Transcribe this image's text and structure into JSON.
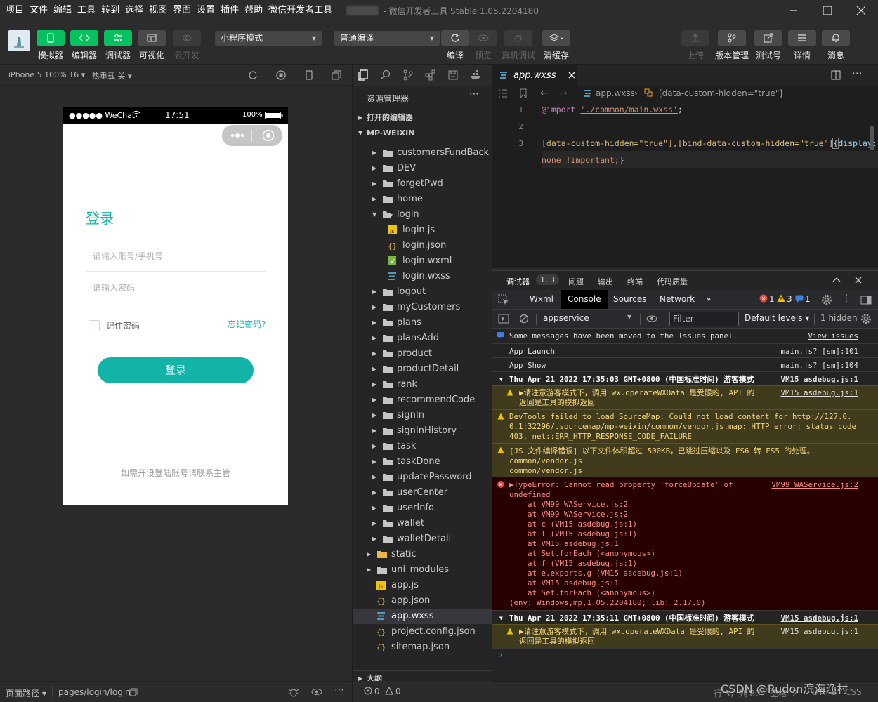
{
  "menu": [
    "项目",
    "文件",
    "编辑",
    "工具",
    "转到",
    "选择",
    "视图",
    "界面",
    "设置",
    "插件",
    "帮助",
    "微信开发者工具"
  ],
  "window_title": "- 微信开发者工具 Stable 1.05.2204180",
  "toolbar": {
    "simulator": "模拟器",
    "editor": "编辑器",
    "debugger": "调试器",
    "visual": "可视化",
    "cloud": "云开发",
    "mode_select": "小程序模式",
    "compile_select": "普通编译",
    "compile": "编译",
    "preview": "预览",
    "real_debug": "真机调试",
    "clear_cache": "清缓存",
    "upload": "上传",
    "version": "版本管理",
    "test_no": "测试号",
    "details": "详情",
    "messages": "消息"
  },
  "sim": {
    "device": "iPhone 5 100% 16",
    "hot_reload": "热重载 关",
    "status": {
      "carrier": "●●●●● WeChat",
      "time": "17:51",
      "battery": "100%"
    },
    "login_title": "登录",
    "account_placeholder": "请输入账号/手机号",
    "password_placeholder": "请输入密码",
    "remember": "记住密码",
    "forgot": "忘记密码?",
    "login_button": "登录",
    "contact": "如需开设登陆账号请联系主管",
    "path_label": "页面路径",
    "path": "pages/login/login"
  },
  "explorer": {
    "title": "资源管理器",
    "open_editors": "打开的编辑器",
    "project": "MP-WEIXIN",
    "outline": "大纲",
    "tree": [
      {
        "name": "customersFundBack",
        "type": "folder",
        "depth": 1,
        "open": false
      },
      {
        "name": "DEV",
        "type": "folder",
        "depth": 1,
        "open": false
      },
      {
        "name": "forgetPwd",
        "type": "folder",
        "depth": 1,
        "open": false
      },
      {
        "name": "home",
        "type": "folder",
        "depth": 1,
        "open": false
      },
      {
        "name": "login",
        "type": "folder",
        "depth": 1,
        "open": true
      },
      {
        "name": "login.js",
        "type": "js",
        "depth": 2
      },
      {
        "name": "login.json",
        "type": "json",
        "depth": 2
      },
      {
        "name": "login.wxml",
        "type": "wxml",
        "depth": 2
      },
      {
        "name": "login.wxss",
        "type": "wxss",
        "depth": 2
      },
      {
        "name": "logout",
        "type": "folder",
        "depth": 1,
        "open": false
      },
      {
        "name": "myCustomers",
        "type": "folder",
        "depth": 1,
        "open": false
      },
      {
        "name": "plans",
        "type": "folder",
        "depth": 1,
        "open": false
      },
      {
        "name": "plansAdd",
        "type": "folder",
        "depth": 1,
        "open": false
      },
      {
        "name": "product",
        "type": "folder",
        "depth": 1,
        "open": false
      },
      {
        "name": "productDetail",
        "type": "folder",
        "depth": 1,
        "open": false
      },
      {
        "name": "rank",
        "type": "folder",
        "depth": 1,
        "open": false
      },
      {
        "name": "recommendCode",
        "type": "folder",
        "depth": 1,
        "open": false
      },
      {
        "name": "signIn",
        "type": "folder",
        "depth": 1,
        "open": false
      },
      {
        "name": "signInHistory",
        "type": "folder",
        "depth": 1,
        "open": false
      },
      {
        "name": "task",
        "type": "folder",
        "depth": 1,
        "open": false
      },
      {
        "name": "taskDone",
        "type": "folder",
        "depth": 1,
        "open": false
      },
      {
        "name": "updatePassword",
        "type": "folder",
        "depth": 1,
        "open": false
      },
      {
        "name": "userCenter",
        "type": "folder",
        "depth": 1,
        "open": false
      },
      {
        "name": "userInfo",
        "type": "folder",
        "depth": 1,
        "open": false
      },
      {
        "name": "wallet",
        "type": "folder",
        "depth": 1,
        "open": false
      },
      {
        "name": "walletDetail",
        "type": "folder",
        "depth": 1,
        "open": false
      },
      {
        "name": "static",
        "type": "folder-yellow",
        "depth": 0,
        "open": false
      },
      {
        "name": "uni_modules",
        "type": "folder",
        "depth": 0,
        "open": false
      },
      {
        "name": "app.js",
        "type": "js",
        "depth": 0
      },
      {
        "name": "app.json",
        "type": "json",
        "depth": 0
      },
      {
        "name": "app.wxss",
        "type": "wxss",
        "depth": 0,
        "selected": true
      },
      {
        "name": "project.config.json",
        "type": "json",
        "depth": 0
      },
      {
        "name": "sitemap.json",
        "type": "json",
        "depth": 0
      }
    ],
    "problems": "0",
    "warnings": "0"
  },
  "editor": {
    "tab": "app.wxss",
    "breadcrumb_file": "app.wxss",
    "breadcrumb_selector": "[data-custom-hidden=\"true\"]",
    "line_numbers": [
      "1",
      "2",
      "3"
    ],
    "code": {
      "l1_kw": "@import",
      "l1_str": "'./common/main.wxss'",
      "l1_end": ";",
      "l3_a": "[data-custom-hidden=\"true\"],[bind-data-custom-hidden=\"true\"]",
      "l3_brace": "{",
      "l3_prop": "display",
      "l3_colon": ":",
      "l3w_val": "none !important",
      "l3w_end": ";}"
    }
  },
  "debugger": {
    "title": "调试器",
    "badge": "1, 3",
    "problems": "问题",
    "output": "输出",
    "terminal": "终端",
    "quality": "代码质量",
    "tabs": [
      "Wxml",
      "Console",
      "Sources",
      "Network"
    ],
    "more_tabs": "»",
    "err_count": "1",
    "warn_count": "3",
    "info_count": "1",
    "context": "appservice",
    "filter_placeholder": "Filter",
    "levels": "Default levels",
    "hidden": "1 hidden",
    "messages": {
      "issues_moved": "Some messages have been moved to the Issues panel.",
      "view_issues": "View issues",
      "app_launch": "App Launch",
      "app_launch_src": "main.js? [sm]:101",
      "app_show": "App Show",
      "app_show_src": "main.js? [sm]:104",
      "group1": "Thu Apr 21 2022 17:35:03 GMT+0800 (中国标准时间) 游客模式",
      "group_src": "VM15 asdebug.js:1",
      "guest_warn_1": "▶请注意游客模式下，调用 wx.operateWXData 是受限的, API 的",
      "guest_warn_2": "返回是工具的模拟返回",
      "sourcemap_1": "DevTools failed to load SourceMap: Could not load content for ",
      "sourcemap_link_1": "http://127.0.",
      "sourcemap_link_2": "0.1:32296/.sourcemap/mp-weixin/common/vendor.js.map",
      "sourcemap_2": ": HTTP error: status code",
      "sourcemap_3": "403, net::ERR_HTTP_RESPONSE_CODE_FAILURE",
      "compile_1": "[JS 文件编译错误] 以下文件体积超过 500KB，已跳过压缩以及 ES6 转 ES5 的处理。",
      "compile_2": "common/vendor.js",
      "compile_3": "common/vendor.js",
      "type_error_1": "▶TypeError: Cannot read property 'forceUpdate' of",
      "type_error_src": "VM99 WAService.js:2",
      "type_error_2": "undefined",
      "stack": [
        "    at VM99 WAService.js:2",
        "    at VM99 WAService.js:2",
        "    at c (VM15 asdebug.js:1)",
        "    at l (VM15 asdebug.js:1)",
        "    at VM15 asdebug.js:1",
        "    at Set.forEach (<anonymous>)",
        "    at f (VM15 asdebug.js:1)",
        "    at e.exports.g (VM15 asdebug.js:1)",
        "    at VM15 asdebug.js:1",
        "    at Set.forEach (<anonymous>)"
      ],
      "env": "(env: Windows,mp,1.05.2204180; lib: 2.17.0)",
      "group2": "Thu Apr 21 2022 17:35:11 GMT+0800 (中国标准时间) 游客模式",
      "prompt": "›"
    }
  },
  "statusbar": {
    "position": "行 3，列 80",
    "spaces": "空格: 2",
    "encoding": "UTF-8",
    "eol": "LF",
    "lang": "CSS"
  },
  "watermark": "CSDN @Rudon滨海渔村",
  "colors": {
    "accent_green": "#07c160",
    "login_teal": "#14b3a8"
  }
}
